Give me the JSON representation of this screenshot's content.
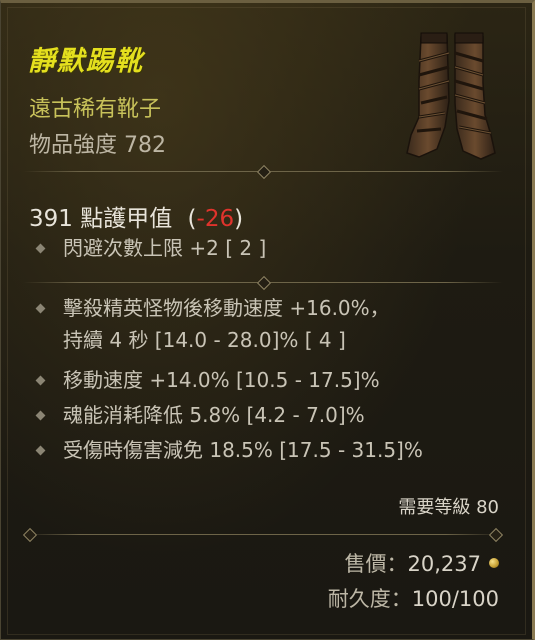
{
  "item": {
    "name": "靜默踢靴",
    "type": "遠古稀有靴子",
    "power": "物品強度 782",
    "image": "boots-icon"
  },
  "armor": {
    "value": "391 點護甲值",
    "open_paren": "(",
    "delta": "-26",
    "close_paren": ")"
  },
  "implicit": [
    "閃避次數上限 +2 [ 2 ]"
  ],
  "affixes": [
    {
      "line1": "擊殺精英怪物後移動速度 +16.0%，",
      "line2": "持續 4 秒 [14.0 - 28.0]% [ 4 ]"
    },
    {
      "line1": "移動速度 +14.0% [10.5 - 17.5]%"
    },
    {
      "line1": "魂能消耗降低 5.8% [4.2 - 7.0]%"
    },
    {
      "line1": "受傷時傷害減免 18.5% [17.5 - 31.5]%"
    }
  ],
  "requirement": "需要等級 80",
  "sell": {
    "label": "售價：",
    "value": "20,237",
    "icon": "gold-coin-icon"
  },
  "durability": {
    "label": "耐久度：",
    "value": "100/100"
  },
  "colors": {
    "name": "#e4df1e",
    "type": "#c8c25a",
    "negative": "#e0332c"
  }
}
